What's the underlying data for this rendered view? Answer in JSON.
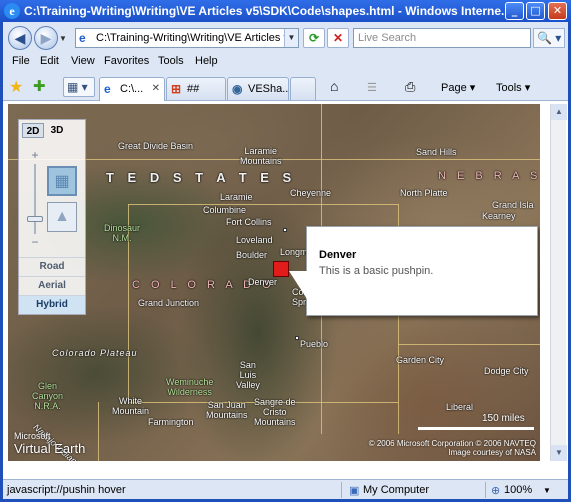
{
  "window": {
    "title": "C:\\Training-Writing\\Writing\\VE Articles v5\\SDK\\Code\\shapes.html - Windows Interne...",
    "min": "_",
    "max": "□",
    "close": "✕"
  },
  "nav": {
    "back": "◀",
    "forward": "▶",
    "address": "C:\\Training-Writing\\Writing\\VE Articles v5\\S",
    "refresh": "⟳",
    "stop": "✕",
    "search_placeholder": "Live Search",
    "search_icon": "🔍"
  },
  "menu": [
    "File",
    "Edit",
    "View",
    "Favorites",
    "Tools",
    "Help"
  ],
  "tabs": [
    {
      "label": "C:\\...",
      "icon": "e",
      "close": "✕",
      "active": true
    },
    {
      "label": "##",
      "icon": "⊞",
      "active": false
    },
    {
      "label": "VESha...",
      "icon": "◉",
      "active": false
    }
  ],
  "commandbar": {
    "home": "⌂",
    "feeds": "☰",
    "print": "⎙",
    "page": "Page ▾",
    "tools": "Tools ▾"
  },
  "map": {
    "dim_2d": "2D",
    "dim_3d": "3D",
    "zoom_in": "+",
    "zoom_out": "−",
    "modes": [
      "Road",
      "Aerial",
      "Hybrid"
    ],
    "active_mode": "Hybrid",
    "labels": {
      "united_states": "T E D   S T A T E S",
      "colorado": "C O L O R A D O",
      "nebraska": "N E B R A S",
      "great_divide": "Great Divide Basin",
      "laramie_mtns": "Laramie\nMountains",
      "sand_hills": "Sand Hills",
      "laramie": "Laramie",
      "cheyenne": "Cheyenne",
      "north_platte": "North Platte",
      "grand_island": "Grand Isla",
      "kearney": "Kearney",
      "columbine": "Columbine",
      "fort_collins": "Fort Collins",
      "dinosaur": "Dinosaur\nN.M.",
      "loveland": "Loveland",
      "boulder": "Boulder",
      "longmont": "Longm",
      "denver": "Denver",
      "grand_junction": "Grand Junction",
      "colorado_springs": "Colo\nSpr",
      "pueblo": "Pueblo",
      "colorado_plateau": "Colorado Plateau",
      "garden_city": "Garden City",
      "dodge_city": "Dodge City",
      "glen_canyon": "Glen\nCanyon\nN.R.A.",
      "weminuche": "Weminuche\nWilderness",
      "san_luis_valley": "San\nLuis\nValley",
      "san_juan_mtns": "San Juan\nMountains",
      "sangre_de_cristo": "Sangre de\nCristo\nMountains",
      "white_mountain": "White\nMountain",
      "farmington": "Farmington",
      "navajo": "Navajo Indian Res.",
      "liberal": "Liberal"
    },
    "popup": {
      "title": "Denver",
      "description": "This is a basic pushpin."
    },
    "scale": "150 miles",
    "logo_small": "Microsoft",
    "logo_big": "Virtual Earth",
    "copyright_1": "© 2006 Microsoft Corporation  © 2006 NAVTEQ",
    "copyright_2": "Image courtesy of NASA"
  },
  "status": {
    "text": "javascript://pushin hover",
    "zone": "My Computer",
    "zoom": "100%"
  }
}
